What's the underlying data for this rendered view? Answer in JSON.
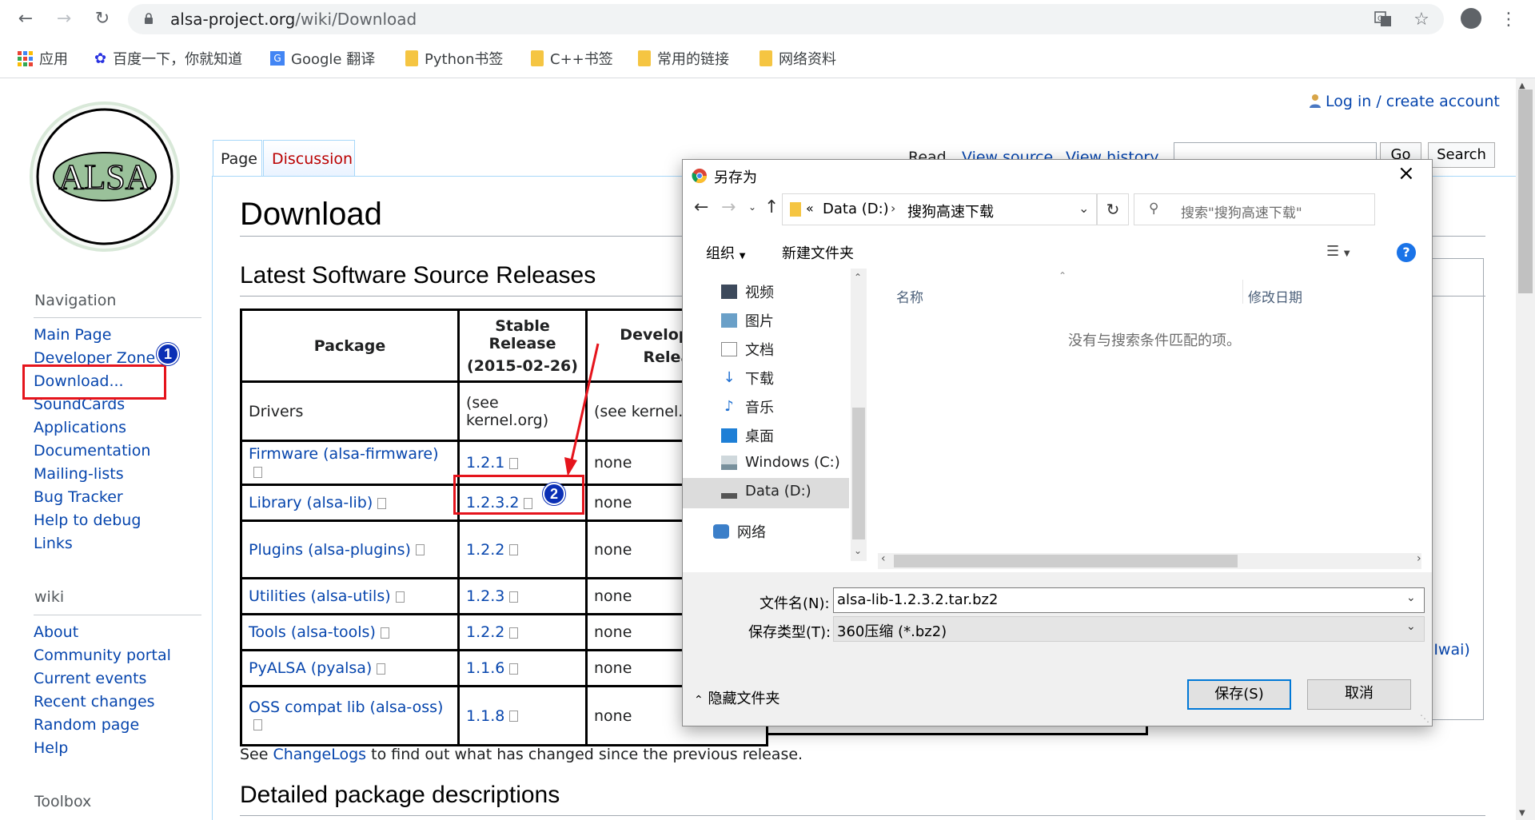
{
  "browser": {
    "url_host": "alsa-project.org",
    "url_path": "/wiki/Download",
    "bookmarks": [
      "应用",
      "百度一下，你就知道",
      "Google 翻译",
      "Python书签",
      "C++书签",
      "常用的链接",
      "网络资料"
    ]
  },
  "wiki": {
    "login": "Log in / create account",
    "tabs": {
      "page": "Page",
      "discussion": "Discussion",
      "read": "Read",
      "view_source": "View source",
      "view_history": "View history"
    },
    "search": {
      "go": "Go",
      "search": "Search"
    },
    "navigation_heading": "Navigation",
    "navigation": [
      "Main Page",
      "Developer Zone",
      "Download...",
      "SoundCards",
      "Applications",
      "Documentation",
      "Mailing-lists",
      "Bug Tracker",
      "Help to debug",
      "Links"
    ],
    "wiki_heading": "wiki",
    "wiki_links": [
      "About",
      "Community portal",
      "Current events",
      "Recent changes",
      "Random page",
      "Help"
    ],
    "toolbox_heading": "Toolbox",
    "title": "Download",
    "section1": "Latest Software Source Releases",
    "section2": "Detailed package descriptions",
    "table": {
      "headers": [
        "Package",
        "Stable Release",
        "(2015-02-26)",
        "Development",
        "Release"
      ],
      "rows": [
        {
          "pkg": "Drivers",
          "stable": "(see kernel.org)",
          "dev": "(see kernel.org)",
          "link": false
        },
        {
          "pkg": "Firmware (alsa-firmware)",
          "stable": "1.2.1",
          "dev": "none",
          "link": true
        },
        {
          "pkg": "Library (alsa-lib)",
          "stable": "1.2.3.2",
          "dev": "none",
          "link": true
        },
        {
          "pkg": "Plugins (alsa-plugins)",
          "stable": "1.2.2",
          "dev": "none",
          "link": true
        },
        {
          "pkg": "Utilities (alsa-utils)",
          "stable": "1.2.3",
          "dev": "none",
          "link": true
        },
        {
          "pkg": "Tools (alsa-tools)",
          "stable": "1.2.2",
          "dev": "none",
          "link": true
        },
        {
          "pkg": "PyALSA (pyalsa)",
          "stable": "1.1.6",
          "dev": "none",
          "link": true
        },
        {
          "pkg": "OSS compat lib (alsa-oss)",
          "stable": "1.1.8",
          "dev": "none",
          "link": true
        }
      ]
    },
    "changelog_pre": "See ",
    "changelog_link": "ChangeLogs",
    "changelog_post": " to find out what has changed since the previous release.",
    "partial_right": "i Iwai)"
  },
  "annotations": {
    "badge1": "1",
    "badge2": "2",
    "accent": "#e5141c"
  },
  "dialog": {
    "title": "另存为",
    "breadcrumb_prefix": "«",
    "breadcrumb_drive": "Data (D:)",
    "breadcrumb_folder": "搜狗高速下载",
    "search_placeholder": "搜索\"搜狗高速下载\"",
    "organize": "组织",
    "new_folder": "新建文件夹",
    "tree": [
      "视频",
      "图片",
      "文档",
      "下载",
      "音乐",
      "桌面",
      "Windows (C:)",
      "Data (D:)",
      "网络"
    ],
    "col_name": "名称",
    "col_modified": "修改日期",
    "empty_message": "没有与搜索条件匹配的项。",
    "filename_label": "文件名(N):",
    "filename_value": "alsa-lib-1.2.3.2.tar.bz2",
    "filetype_label": "保存类型(T):",
    "filetype_value": "360压缩 (*.bz2)",
    "hide_folders": "隐藏文件夹",
    "save": "保存(S)",
    "cancel": "取消"
  }
}
